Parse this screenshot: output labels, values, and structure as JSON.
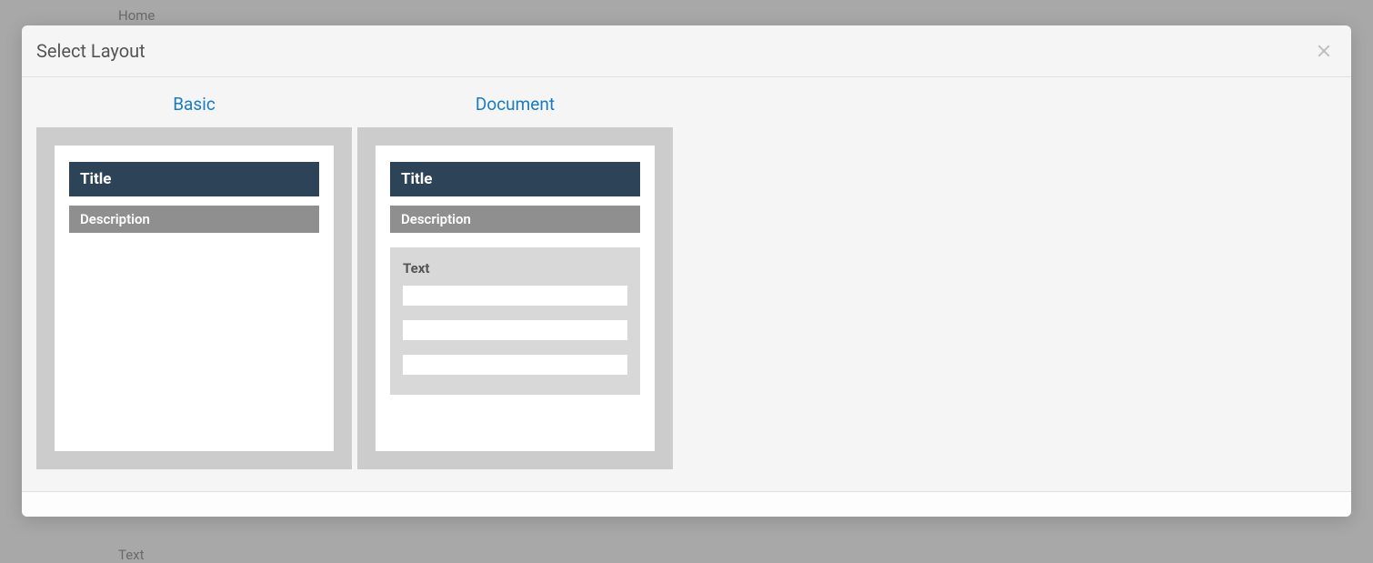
{
  "background": {
    "home": "Home",
    "text": "Text"
  },
  "modal": {
    "title": "Select Layout",
    "layouts": [
      {
        "name": "Basic",
        "preview": {
          "title": "Title",
          "description": "Description"
        }
      },
      {
        "name": "Document",
        "preview": {
          "title": "Title",
          "description": "Description",
          "text_label": "Text"
        }
      }
    ]
  }
}
